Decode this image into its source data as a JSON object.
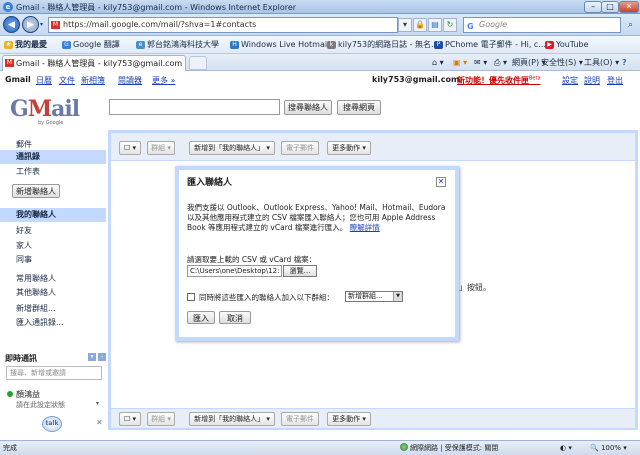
{
  "window": {
    "title": "Gmail - 聯絡人管理員 - kily753@gmail.com - Windows Internet Explorer",
    "min": "–",
    "max": "□",
    "close": "✕"
  },
  "address": {
    "url": "https://mail.google.com/mail/?shva=1#contacts",
    "search_placeholder": "Google",
    "search_brand": "G"
  },
  "favorites": {
    "label": "我的最愛",
    "items": [
      "Google 翻譯",
      "郭台銘鴻海科技大學",
      "Windows Live Hotmail",
      "kily753的網路日誌 - 無名...",
      "PChome 電子郵件 - Hi, c...",
      "YouTube"
    ]
  },
  "tab": {
    "label": "Gmail - 聯絡人管理員 - kily753@gmail.com"
  },
  "commandbar": {
    "page": "網頁(P) ▾",
    "safety": "安全性(S) ▾",
    "tools": "工具(O) ▾",
    "help": "?"
  },
  "gmail_top": {
    "brand": "Gmail",
    "links": [
      "日曆",
      "文件",
      "新相簿",
      "閱讀器",
      "更多 »"
    ],
    "email": "kily753@gmail.com",
    "new_feature": "新功能！優先收件匣",
    "new_badge": "Beta",
    "settings": "設定",
    "help": "說明",
    "signout": "登出"
  },
  "logo": {
    "g": "G",
    "m": "M",
    "ail": "ail",
    "by": "by Google"
  },
  "search": {
    "btn_contacts": "搜尋聯絡人",
    "btn_web": "搜尋網頁"
  },
  "sidebar": {
    "mail": "郵件",
    "contacts": "通訊錄",
    "tasks": "工作表",
    "new_contact": "新增聯絡人",
    "my_contacts": "我的聯絡人",
    "friends": "好友",
    "family": "家人",
    "coworkers": "同事",
    "frequent": "常用聯絡人",
    "other": "其他聯絡人",
    "new_group": "新增群組...",
    "import": "匯入通訊錄..."
  },
  "toolbar": {
    "group": "群組 ▾",
    "add_to": "新增到「我的聯絡人」 ▾",
    "email": "電子郵件",
    "more": "更多動作 ▾"
  },
  "bg_text": "」按鈕。",
  "chat": {
    "title": "即時通訊",
    "search_placeholder": "搜尋、新增或邀請",
    "user": "顏鴻益",
    "status": "請在此設定狀態",
    "talk": "talk"
  },
  "dialog": {
    "title": "匯入聯絡人",
    "close": "✕",
    "desc": "我們支援以 Outlook、Outlook Express、Yahoo! Mail、Hotmail、Eudora 以及其他應用程式建立的 CSV 檔案匯入聯絡人；您也可用 Apple Address Book 等應用程式建立的 vCard 檔案進行匯入。",
    "help_link": "瞭解詳情",
    "file_label": "請選取要上載的 CSV 或 vCard 檔案：",
    "file_path": "C:\\Users\\one\\Desktop\\12:",
    "browse": "瀏覽...",
    "group_label": "同時將這些匯入的聯絡人加入以下群組：",
    "group_select": "新增群組...",
    "import": "匯入",
    "cancel": "取消"
  },
  "status": {
    "left": "完成",
    "zone": "網際網路 | 受保護模式: 關閉",
    "zoom": "100%"
  }
}
